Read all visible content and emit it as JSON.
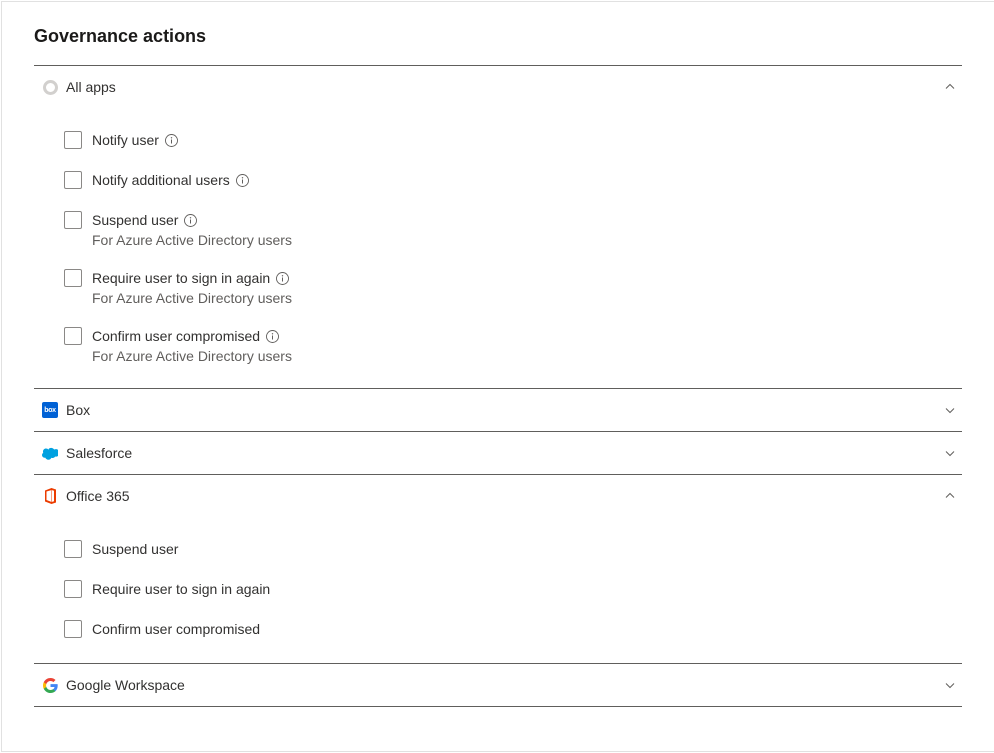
{
  "title": "Governance actions",
  "sections": {
    "all_apps": {
      "label": "All apps",
      "expanded": true,
      "items": [
        {
          "label": "Notify user",
          "has_info": true,
          "subtext": null
        },
        {
          "label": "Notify additional users",
          "has_info": true,
          "subtext": null
        },
        {
          "label": "Suspend user",
          "has_info": true,
          "subtext": "For Azure Active Directory users"
        },
        {
          "label": "Require user to sign in again",
          "has_info": true,
          "subtext": "For Azure Active Directory users"
        },
        {
          "label": "Confirm user compromised",
          "has_info": true,
          "subtext": "For Azure Active Directory users"
        }
      ]
    },
    "box": {
      "label": "Box",
      "expanded": false
    },
    "salesforce": {
      "label": "Salesforce",
      "expanded": false
    },
    "office365": {
      "label": "Office 365",
      "expanded": true,
      "items": [
        {
          "label": "Suspend user",
          "has_info": false,
          "subtext": null
        },
        {
          "label": "Require user to sign in again",
          "has_info": false,
          "subtext": null
        },
        {
          "label": "Confirm user compromised",
          "has_info": false,
          "subtext": null
        }
      ]
    },
    "google": {
      "label": "Google Workspace",
      "expanded": false
    }
  }
}
